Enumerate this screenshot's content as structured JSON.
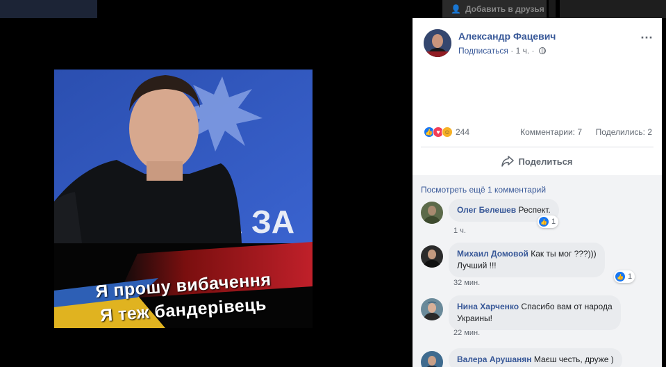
{
  "background": {
    "add_friend_label": "Добавить в друзья"
  },
  "photo": {
    "caption_line1": "Я прошу вибачення",
    "caption_line2": "Я теж бандерівець",
    "wall_text": "А ЗА"
  },
  "post": {
    "author": "Александр Фацевич",
    "subscribe_label": "Подписаться",
    "time": "1 ч.",
    "more_icon": "⋯",
    "reaction_count": "244",
    "comments_label": "Комментарии: 7",
    "shares_label": "Поделились: 2",
    "share_button_label": "Поделиться"
  },
  "comments_section": {
    "view_more_label": "Посмотреть ещё 1 комментарий",
    "items": [
      {
        "author": "Олег Белешев",
        "text": "Респект.",
        "time": "1 ч.",
        "likes": "1"
      },
      {
        "author": "Михаил Домовой",
        "text": "Как ты мог ???)))",
        "text_line2": "Лучший !!!",
        "time": "32 мин.",
        "likes": "1"
      },
      {
        "author": "Нина Харченко",
        "text": "Спасибо вам от народа",
        "text_line2": "Украины!",
        "time": "22 мин."
      },
      {
        "author": "Валера Арушанян",
        "text": "Маєш честь, друже )"
      }
    ]
  },
  "colors": {
    "link_blue": "#385898",
    "like_blue": "#1877f2",
    "love_red": "#f33e58",
    "haha_yellow": "#f7b125"
  }
}
